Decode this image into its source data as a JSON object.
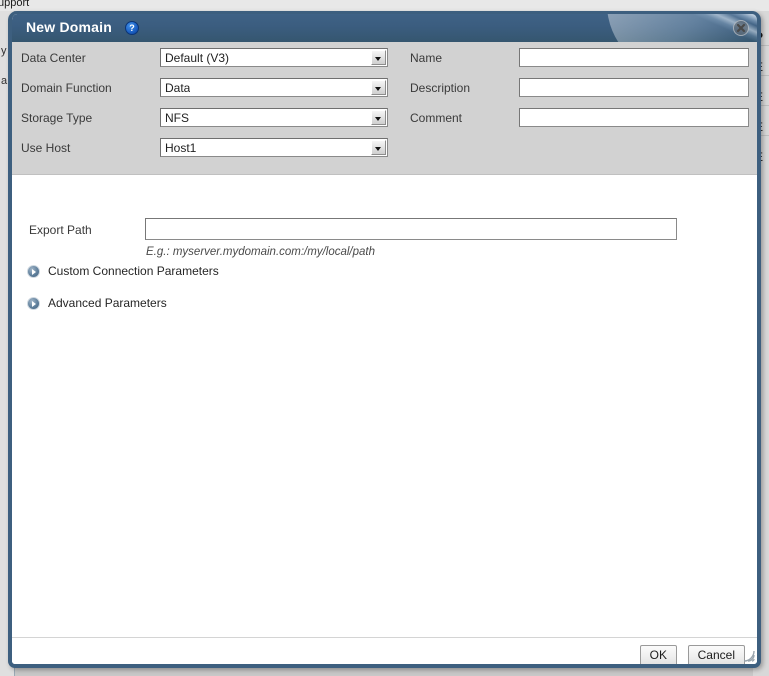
{
  "background": {
    "topbar_text": "upport",
    "left_fragments": [
      "y",
      "a"
    ],
    "right_fragments": [
      "P",
      "E",
      "E",
      "E",
      "E"
    ]
  },
  "dialog": {
    "title": "New Domain",
    "help_icon": "question-mark-icon",
    "close_icon": "close-icon",
    "form": {
      "left_fields": [
        {
          "label": "Data Center",
          "value": "Default (V3)",
          "type": "combo"
        },
        {
          "label": "Domain Function",
          "value": "Data",
          "type": "combo"
        },
        {
          "label": "Storage Type",
          "value": "NFS",
          "type": "combo"
        },
        {
          "label": "Use Host",
          "value": "Host1",
          "type": "combo"
        }
      ],
      "right_fields": [
        {
          "label": "Name",
          "value": "",
          "placeholder": "",
          "type": "text"
        },
        {
          "label": "Description",
          "value": "",
          "placeholder": "",
          "type": "text"
        },
        {
          "label": "Comment",
          "value": "",
          "placeholder": "",
          "type": "text"
        }
      ]
    },
    "export": {
      "label": "Export Path",
      "value": "",
      "placeholder": "",
      "hint": "E.g.: myserver.mydomain.com:/my/local/path"
    },
    "expanders": [
      {
        "label": "Custom Connection Parameters",
        "icon": "chevron-right-circle-icon",
        "expanded": false
      },
      {
        "label": "Advanced Parameters",
        "icon": "chevron-right-circle-icon",
        "expanded": false
      }
    ],
    "buttons": {
      "ok": "OK",
      "cancel": "Cancel"
    }
  },
  "colors": {
    "titlebar": "#3b5d7f",
    "dialog_border": "#3d5f7f",
    "form_panel": "#d2d2d2",
    "page_bg": "#c8c8c8",
    "help_blue": "#1b5fc2"
  }
}
